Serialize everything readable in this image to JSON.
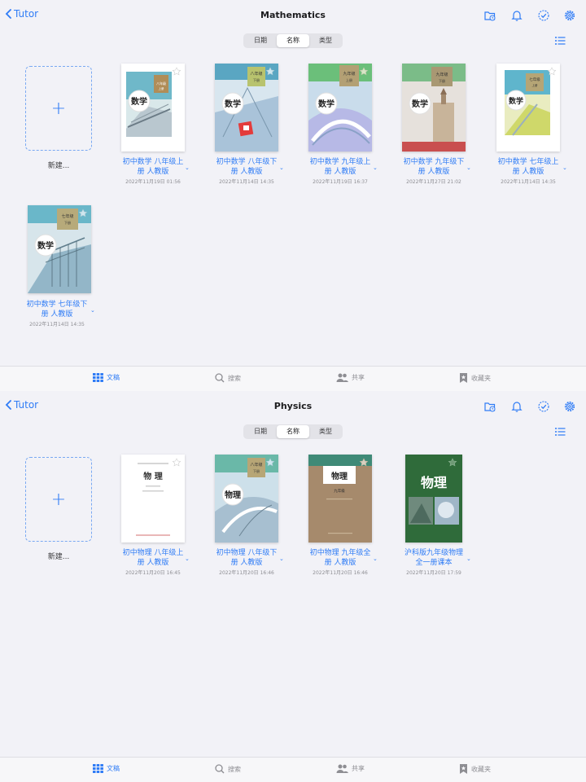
{
  "colors": {
    "accent": "#2f7cf6",
    "background": "#f2f2f7"
  },
  "panels": [
    {
      "back_label": "Tutor",
      "title": "Mathematics",
      "segments": [
        "日期",
        "名称",
        "类型"
      ],
      "active_segment": "名称",
      "new_label": "新建...",
      "books": [
        {
          "name_line1": "初中数学 八年级上",
          "name_line2": "册 人教版",
          "date": "2022年11月19日 01:56",
          "cover_text": "数学",
          "cover_grade": "八年级",
          "cover_term": "上册"
        },
        {
          "name_line1": "初中数学 八年级下",
          "name_line2": "册 人教版",
          "date": "2022年11月14日 14:35",
          "cover_text": "数学",
          "cover_grade": "八年级",
          "cover_term": "下册"
        },
        {
          "name_line1": "初中数学 九年级上",
          "name_line2": "册 人教版",
          "date": "2022年11月19日 16:37",
          "cover_text": "数学",
          "cover_grade": "九年级",
          "cover_term": "上册"
        },
        {
          "name_line1": "初中数学 九年级下",
          "name_line2": "册 人教版",
          "date": "2022年11月27日 21:02",
          "cover_text": "数学",
          "cover_grade": "九年级",
          "cover_term": "下册"
        },
        {
          "name_line1": "初中数学 七年级上",
          "name_line2": "册 人教版",
          "date": "2022年11月14日 14:35",
          "cover_text": "数学",
          "cover_grade": "七年级",
          "cover_term": "上册"
        },
        {
          "name_line1": "初中数学 七年级下",
          "name_line2": "册 人教版",
          "date": "2022年11月14日 14:35",
          "cover_text": "数学",
          "cover_grade": "七年级",
          "cover_term": "下册"
        }
      ],
      "tabs": [
        "文稿",
        "搜索",
        "共享",
        "收藏夹"
      ]
    },
    {
      "back_label": "Tutor",
      "title": "Physics",
      "segments": [
        "日期",
        "名称",
        "类型"
      ],
      "active_segment": "名称",
      "new_label": "新建...",
      "books": [
        {
          "name_line1": "初中物理 八年级上",
          "name_line2": "册 人教版",
          "date": "2022年11月20日 16:45",
          "cover_text": "物 理",
          "cover_grade": "",
          "cover_term": ""
        },
        {
          "name_line1": "初中物理 八年级下",
          "name_line2": "册 人教版",
          "date": "2022年11月20日 16:46",
          "cover_text": "物理",
          "cover_grade": "八年级",
          "cover_term": "下册"
        },
        {
          "name_line1": "初中物理 九年级全",
          "name_line2": "册 人教版",
          "date": "2022年11月20日 16:46",
          "cover_text": "物理",
          "cover_grade": "九年级",
          "cover_term": ""
        },
        {
          "name_line1": "沪科版九年级物理",
          "name_line2": "全一册课本",
          "date": "2022年11月20日 17:59",
          "cover_text": "物理",
          "cover_grade": "",
          "cover_term": ""
        }
      ],
      "tabs": [
        "文稿",
        "搜索",
        "共享",
        "收藏夹"
      ]
    }
  ]
}
